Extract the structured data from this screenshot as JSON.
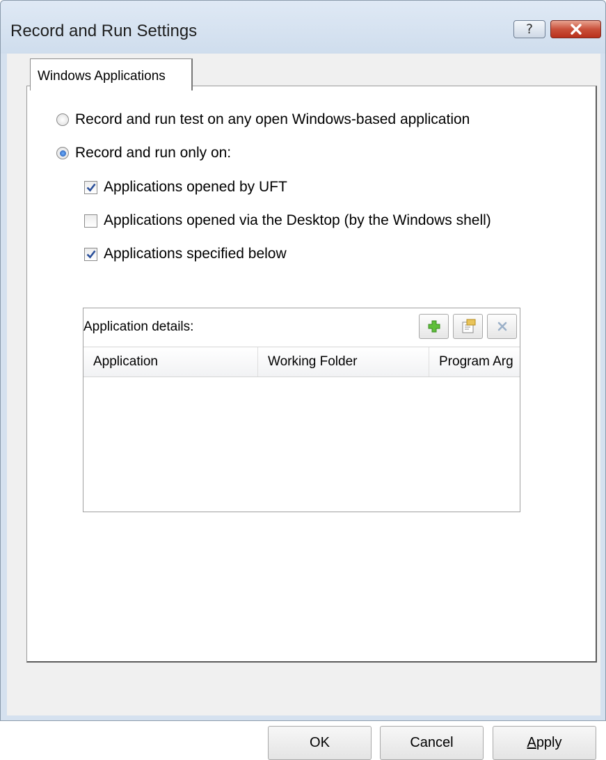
{
  "window": {
    "title": "Record and Run Settings",
    "help_label": "?"
  },
  "tabs": [
    {
      "label": "Windows Applications"
    }
  ],
  "options": {
    "any_app_label": "Record and run test on any open Windows-based application",
    "only_on_label": "Record and run only on:",
    "selected": "only_on",
    "checks": [
      {
        "label": "Applications opened by UFT",
        "checked": true
      },
      {
        "label": "Applications opened via the Desktop (by the Windows shell)",
        "checked": false
      },
      {
        "label": "Applications specified below",
        "checked": true
      }
    ]
  },
  "grid": {
    "caption": "Application details:",
    "columns": [
      "Application",
      "Working Folder",
      "Program Arg"
    ],
    "toolbar": [
      {
        "icon": "add-icon"
      },
      {
        "icon": "edit-properties-icon"
      },
      {
        "icon": "delete-icon"
      }
    ]
  },
  "buttons": {
    "ok": "OK",
    "cancel": "Cancel",
    "apply_prefix": "A",
    "apply_rest": "pply"
  }
}
